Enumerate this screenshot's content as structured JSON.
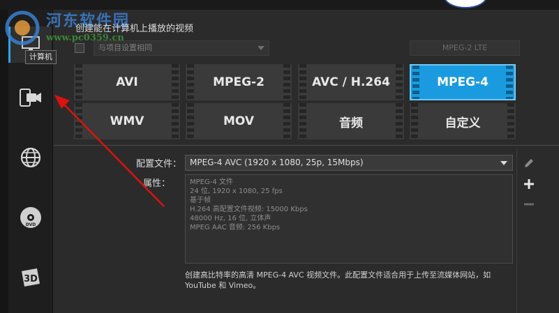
{
  "watermark": {
    "title": "河东软件园",
    "url": "www.pc0359.cn"
  },
  "sidebar": {
    "tooltip": "计算机",
    "items": [
      {
        "name": "computer",
        "icon": "computer-icon",
        "active": true
      },
      {
        "name": "device",
        "icon": "device-camera-icon",
        "active": false
      },
      {
        "name": "online",
        "icon": "globe-icon",
        "active": false
      },
      {
        "name": "disc",
        "icon": "dvd-icon",
        "active": false
      },
      {
        "name": "3d",
        "icon": "3d-icon",
        "active": false
      }
    ]
  },
  "header": {
    "title": "创建能在计算机上播放的视频",
    "same_as_project_label": "与项目设置相同",
    "disabled_button": "MPEG-2 LTE"
  },
  "formats": [
    {
      "label": "AVI",
      "selected": false
    },
    {
      "label": "MPEG-2",
      "selected": false
    },
    {
      "label": "AVC / H.264",
      "selected": false
    },
    {
      "label": "MPEG-4",
      "selected": true
    },
    {
      "label": "WMV",
      "selected": false
    },
    {
      "label": "MOV",
      "selected": false
    },
    {
      "label": "音频",
      "selected": false
    },
    {
      "label": "自定义",
      "selected": false
    }
  ],
  "profile": {
    "label": "配置文件：",
    "value": "MPEG-4 AVC (1920 x 1080, 25p, 15Mbps)"
  },
  "properties": {
    "label": "属性：",
    "lines": [
      "MPEG-4 文件",
      "24 位, 1920 x 1080, 25 fps",
      "基于帧",
      "H.264 高配置文件视频: 15000 Kbps",
      "48000 Hz, 16 位, 立体声",
      "MPEG AAC 音频: 256 Kbps"
    ]
  },
  "description": "创建高比特率的高清 MPEG-4 AVC 视频文件。此配置文件适合用于上传至流媒体网站，如 YouTube 和 Vimeo。",
  "colors": {
    "accent": "#1a9be0",
    "arrow": "#e01010"
  }
}
